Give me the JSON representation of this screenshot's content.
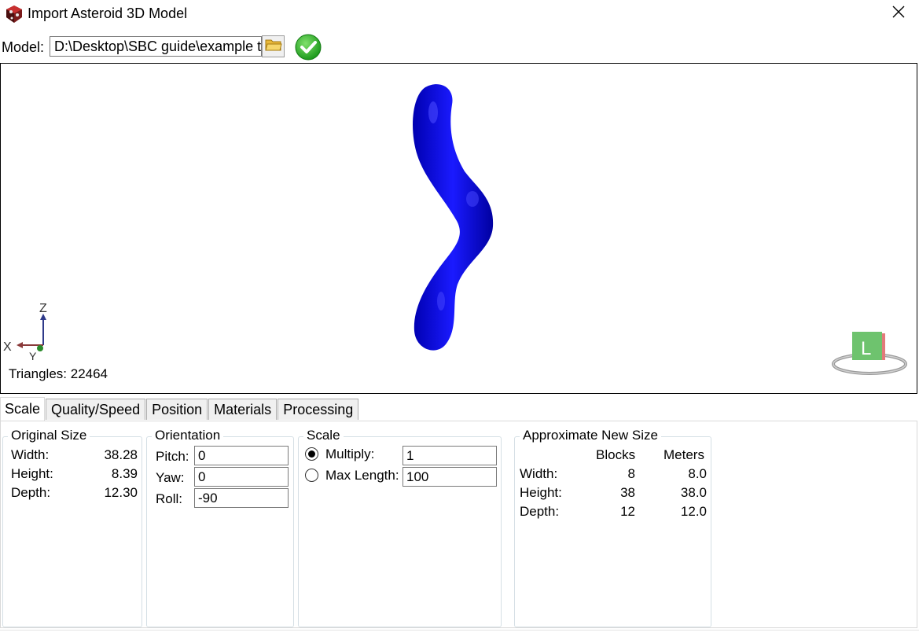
{
  "window": {
    "title": "Import Asteroid 3D Model",
    "close_symbol": "✕",
    "icon": "asteroid-app-icon"
  },
  "model": {
    "label": "Model:",
    "path": "D:\\Desktop\\SBC guide\\example te",
    "browse_icon": "folder-icon",
    "status_icon": "green-checkmark-icon"
  },
  "viewport": {
    "axis_z": "Z",
    "axis_x": "X",
    "axis_y": "Y",
    "triangles_label": "Triangles: 22464",
    "light_label": "L",
    "model_color": "#0a0ad6"
  },
  "tabs": [
    {
      "label": "Scale",
      "active": true
    },
    {
      "label": "Quality/Speed",
      "active": false
    },
    {
      "label": "Position",
      "active": false
    },
    {
      "label": "Materials",
      "active": false
    },
    {
      "label": "Processing",
      "active": false
    }
  ],
  "original_size": {
    "title": "Original Size",
    "rows": [
      {
        "label": "Width:",
        "value": "38.28"
      },
      {
        "label": "Height:",
        "value": "8.39"
      },
      {
        "label": "Depth:",
        "value": "12.30"
      }
    ]
  },
  "orientation": {
    "title": "Orientation",
    "rows": [
      {
        "label": "Pitch:",
        "value": "0"
      },
      {
        "label": "Yaw:",
        "value": "0"
      },
      {
        "label": "Roll:",
        "value": "-90"
      }
    ]
  },
  "scale": {
    "title": "Scale",
    "options": [
      {
        "label": "Multiply:",
        "value": "1",
        "checked": true
      },
      {
        "label": "Max Length:",
        "value": "100",
        "checked": false
      }
    ]
  },
  "new_size": {
    "title": "Approximate New Size",
    "col_blocks": "Blocks",
    "col_meters": "Meters",
    "rows": [
      {
        "label": "Width:",
        "blocks": "8",
        "meters": "8.0"
      },
      {
        "label": "Height:",
        "blocks": "38",
        "meters": "38.0"
      },
      {
        "label": "Depth:",
        "blocks": "12",
        "meters": "12.0"
      }
    ]
  }
}
